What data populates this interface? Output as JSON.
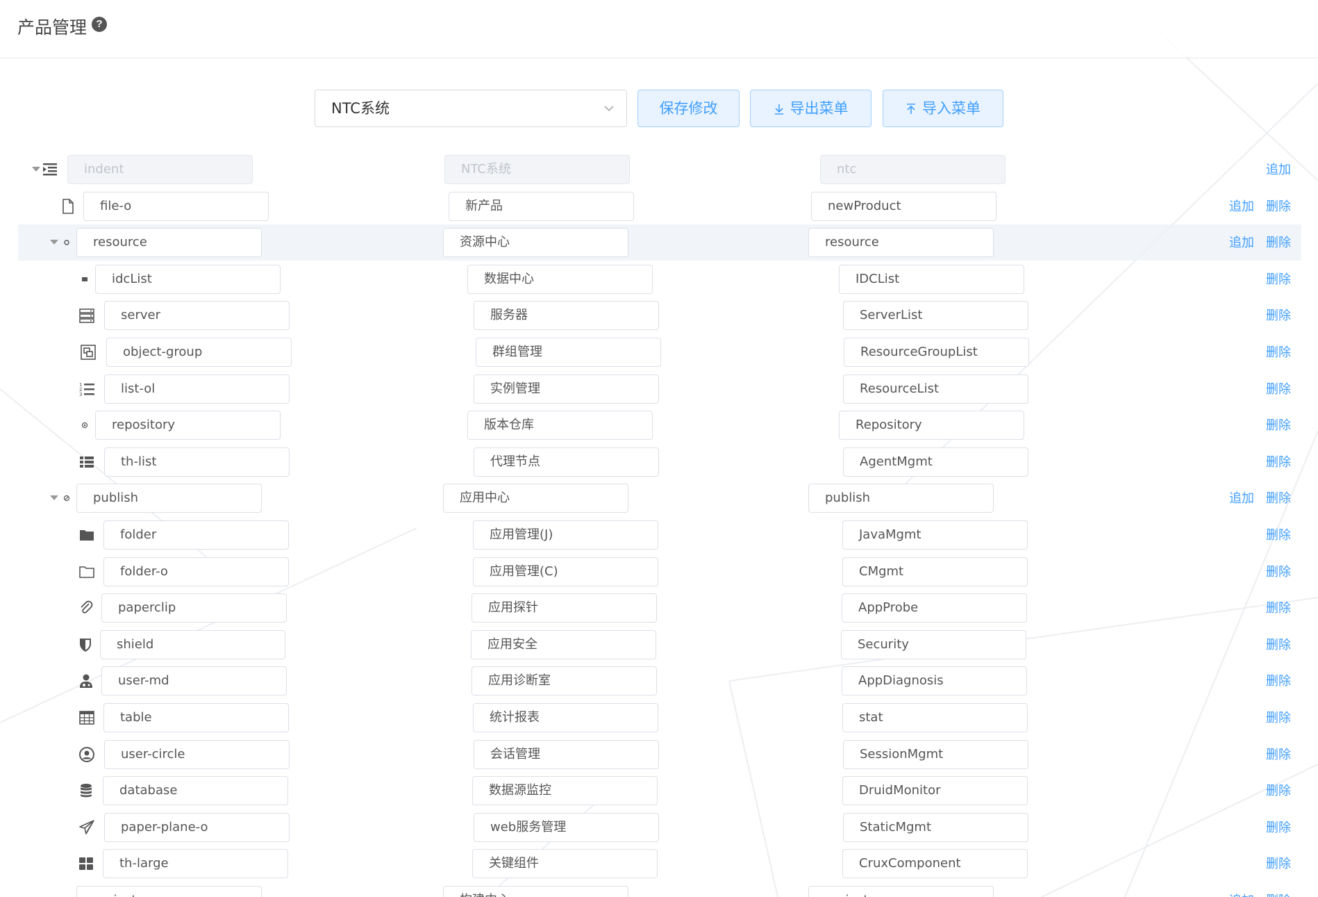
{
  "header": {
    "title": "产品管理",
    "help_icon": "question-circle-icon"
  },
  "toolbar": {
    "system_select": "NTC系统",
    "save_label": "保存修改",
    "export_label": "导出菜单",
    "import_label": "导入菜单"
  },
  "colors": {
    "accent": "#409eff",
    "button_bg": "#e8f3ff",
    "border": "#dcdfe6",
    "highlight_row": "#eef2f7"
  },
  "actions": {
    "add": "追加",
    "delete": "删除"
  },
  "rows": [
    {
      "icon": "indent-icon",
      "name": "indent",
      "title": "NTC系统",
      "key": "ntc",
      "expandable": true,
      "disabled": true,
      "add": true,
      "del": false
    },
    {
      "icon": "file-o-icon",
      "name": "file-o",
      "title": "新产品",
      "key": "newProduct",
      "add": true,
      "del": true
    },
    {
      "icon": "resource-icon",
      "name": "resource",
      "title": "资源中心",
      "key": "resource",
      "expandable": true,
      "add": true,
      "del": true,
      "highlight": true
    },
    {
      "icon": "idclist-icon",
      "name": "idcList",
      "title": "数据中心",
      "key": "IDCList",
      "del": true
    },
    {
      "icon": "server-icon",
      "name": "server",
      "title": "服务器",
      "key": "ServerList",
      "del": true
    },
    {
      "icon": "object-group-icon",
      "name": "object-group",
      "title": "群组管理",
      "key": "ResourceGroupList",
      "del": true
    },
    {
      "icon": "list-ol-icon",
      "name": "list-ol",
      "title": "实例管理",
      "key": "ResourceList",
      "del": true
    },
    {
      "icon": "repository-icon",
      "name": "repository",
      "title": "版本仓库",
      "key": "Repository",
      "del": true
    },
    {
      "icon": "th-list-icon",
      "name": "th-list",
      "title": "代理节点",
      "key": "AgentMgmt",
      "del": true
    },
    {
      "icon": "publish-icon",
      "name": "publish",
      "title": "应用中心",
      "key": "publish",
      "expandable": true,
      "add": true,
      "del": true
    },
    {
      "icon": "folder-icon",
      "name": "folder",
      "title": "应用管理(J)",
      "key": "JavaMgmt",
      "del": true
    },
    {
      "icon": "folder-o-icon",
      "name": "folder-o",
      "title": "应用管理(C)",
      "key": "CMgmt",
      "del": true
    },
    {
      "icon": "paperclip-icon",
      "name": "paperclip",
      "title": "应用探针",
      "key": "AppProbe",
      "del": true
    },
    {
      "icon": "shield-icon",
      "name": "shield",
      "title": "应用安全",
      "key": "Security",
      "del": true
    },
    {
      "icon": "user-md-icon",
      "name": "user-md",
      "title": "应用诊断室",
      "key": "AppDiagnosis",
      "del": true
    },
    {
      "icon": "table-icon",
      "name": "table",
      "title": "统计报表",
      "key": "stat",
      "del": true
    },
    {
      "icon": "user-circle-icon",
      "name": "user-circle",
      "title": "会话管理",
      "key": "SessionMgmt",
      "del": true
    },
    {
      "icon": "database-icon",
      "name": "database",
      "title": "数据源监控",
      "key": "DruidMonitor",
      "del": true
    },
    {
      "icon": "paper-plane-o-icon",
      "name": "paper-plane-o",
      "title": "web服务管理",
      "key": "StaticMgmt",
      "del": true
    },
    {
      "icon": "th-large-icon",
      "name": "th-large",
      "title": "关键组件",
      "key": "CruxComponent",
      "del": true
    },
    {
      "icon": "project-icon",
      "name": "project",
      "title": "构建中心",
      "key": "project",
      "expandable": true,
      "add": true,
      "del": true
    }
  ]
}
